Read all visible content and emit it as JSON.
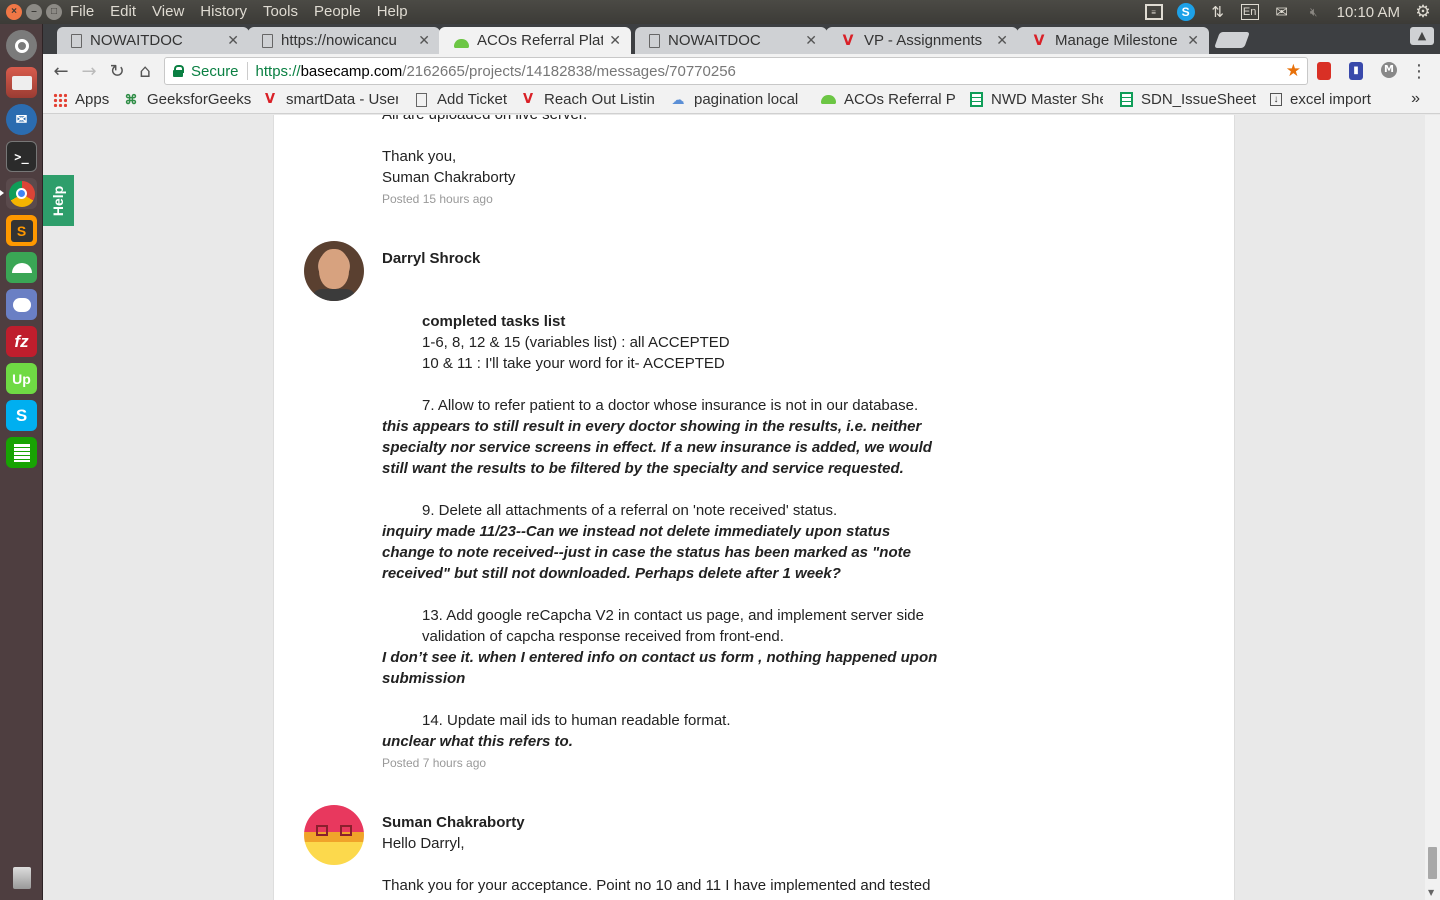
{
  "top_panel": {
    "menus": [
      "File",
      "Edit",
      "View",
      "History",
      "Tools",
      "People",
      "Help"
    ],
    "keyboard_layout": "En",
    "clock": "10:10 AM"
  },
  "launcher": {
    "items": [
      {
        "name": "dash-home",
        "icon": "ubuntu-logo",
        "color": "#8a8a8a"
      },
      {
        "name": "file-manager",
        "icon": "file-cabinet",
        "color": "#c0504d"
      },
      {
        "name": "thunderbird",
        "icon": "thunderbird-logo",
        "color": "#2b6cb0"
      },
      {
        "name": "terminal",
        "icon": "terminal",
        "color": "#2b2b2b"
      },
      {
        "name": "chrome",
        "icon": "chrome-logo",
        "color": "#f4b400"
      },
      {
        "name": "sublime-text",
        "icon": "sublime-s",
        "color": "#4a4a4a"
      },
      {
        "name": "remmina",
        "icon": "remote-desktop",
        "color": "#3aa655"
      },
      {
        "name": "pidgin",
        "icon": "chat-bubble",
        "color": "#6a7fc4"
      },
      {
        "name": "filezilla",
        "icon": "filezilla-fz",
        "color": "#bf1e2d"
      },
      {
        "name": "upwork",
        "icon": "upwork-logo",
        "color": "#6fda44"
      },
      {
        "name": "skype",
        "icon": "skype-logo",
        "color": "#00aff0"
      },
      {
        "name": "libreoffice-calc",
        "icon": "spreadsheet",
        "color": "#18a303"
      },
      {
        "name": "trash",
        "icon": "trash-can",
        "color": "#9a9a9a"
      }
    ]
  },
  "tabs": [
    {
      "title": "NOWAITDOC",
      "icon": "doc-icon",
      "active": false
    },
    {
      "title": "https://nowicancu",
      "icon": "doc-icon",
      "active": false
    },
    {
      "title": "ACOs Referral Platf",
      "icon": "basecamp-icon",
      "active": true
    },
    {
      "title": "NOWAITDOC",
      "icon": "doc-icon",
      "active": false
    },
    {
      "title": "VP - Assignments",
      "icon": "v-icon",
      "active": false
    },
    {
      "title": "Manage Milestone",
      "icon": "v-icon",
      "active": false
    }
  ],
  "address_bar": {
    "secure_label": "Secure",
    "url_scheme": "https://",
    "url_host": "basecamp.com",
    "url_path": "/2162665/projects/14182838/messages/70770256"
  },
  "bookmarks": [
    {
      "label": "Apps",
      "icon": "apps-grid-icon"
    },
    {
      "label": "GeeksforGeeks",
      "icon": "gfg-icon"
    },
    {
      "label": "smartData - User",
      "icon": "v-icon"
    },
    {
      "label": "Add Ticket",
      "icon": "doc-icon"
    },
    {
      "label": "Reach Out Listin",
      "icon": "v-icon"
    },
    {
      "label": "pagination local",
      "icon": "cloud-icon"
    },
    {
      "label": "ACOs Referral Pl",
      "icon": "basecamp-icon"
    },
    {
      "label": "NWD Master She",
      "icon": "sheets-icon"
    },
    {
      "label": "SDN_IssueSheet",
      "icon": "sheets-icon"
    },
    {
      "label": "excel import",
      "icon": "download-icon"
    }
  ],
  "help_tab": "Help",
  "messages": {
    "prev_tail": {
      "cut_line": "All are uploaded on live server.",
      "thanks": "Thank you,",
      "signature": "Suman Chakraborty",
      "posted": "Posted 15 hours ago"
    },
    "darryl": {
      "author": "Darryl Shrock",
      "heading": "completed tasks list",
      "line1": "1-6, 8, 12 & 15 (variables list) :  all ACCEPTED",
      "line2": "10 & 11 :   I'll take your word for it- ACCEPTED",
      "item7": "7. Allow to refer patient to a doctor whose insurance is not in our database.",
      "reply7_1": "this appears to still result in every doctor showing in the results, i.e. neither",
      "reply7_2": "specialty nor service screens in effect. If a new insurance is added, we would",
      "reply7_3": "still want the results to be filtered by the specialty and service requested.",
      "item9": "9. Delete all attachments of a referral on 'note received' status.",
      "reply9_1": " inquiry made 11/23--Can we instead not delete immediately upon status",
      "reply9_2": "change to note received--just in case the status has been marked as \"note",
      "reply9_3": "received\" but still not downloaded. Perhaps delete after 1 week?",
      "item13_1": "13. Add google reCapcha V2 in contact us page, and implement server side",
      "item13_2": "validation of capcha response received from front-end.",
      "reply13_1": "I don’t see it. when I entered info on contact us form , nothing happened upon",
      "reply13_2": "submission",
      "item14": "14. Update mail ids to human readable format.",
      "reply14": "unclear what this refers to.",
      "posted": "Posted 7 hours ago"
    },
    "suman": {
      "author": "Suman Chakraborty",
      "greeting": "Hello Darryl,",
      "line1": "Thank you for your acceptance. Point no 10 and 11 I have implemented and tested"
    }
  }
}
